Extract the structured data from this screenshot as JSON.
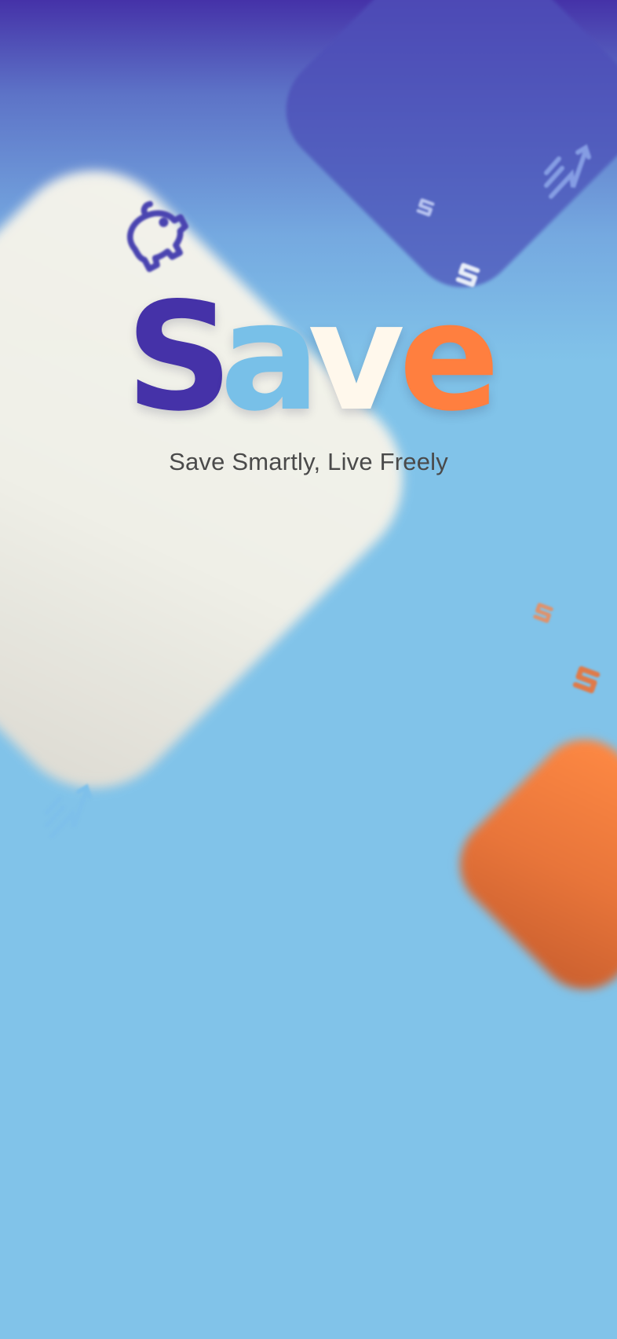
{
  "logo": {
    "letters": [
      "S",
      "a",
      "v",
      "e"
    ],
    "colors": [
      "#4532a8",
      "#78c0e8",
      "#fff8ec",
      "#ff7f3f"
    ]
  },
  "tagline": "Save Smartly, Live Freely",
  "colors": {
    "background": "#81c3e9",
    "purple": "#4532a8",
    "cream": "#f3f1e8",
    "orange": "#ff7f3f"
  },
  "icons": [
    "piggy-bank-icon",
    "growth-arrow-icon",
    "dollar-sign-icon"
  ]
}
